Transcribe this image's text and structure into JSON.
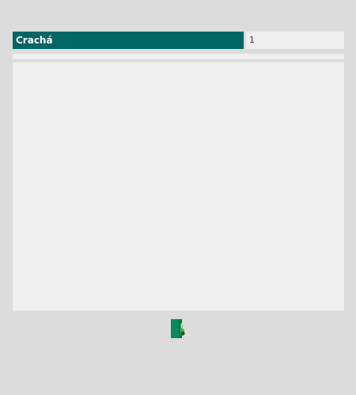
{
  "field": {
    "label": "Crachá",
    "value": "1"
  },
  "icons": {
    "footer_icon": "green-document-icon"
  },
  "colors": {
    "label_background": "#006666",
    "label_text": "#ffffff",
    "panel_background": "#efefef",
    "page_background": "#dcdcdc",
    "icon_primary": "#0a8a5a",
    "icon_accent": "#4caf50"
  }
}
